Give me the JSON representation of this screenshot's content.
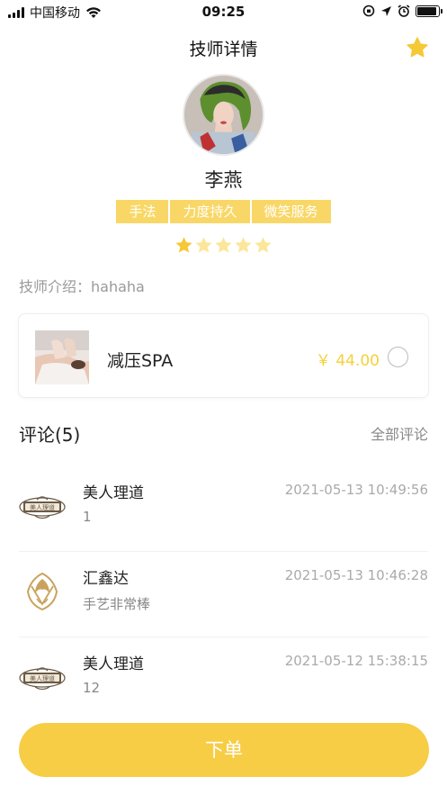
{
  "status_bar": {
    "carrier": "中国移动",
    "time": "09:25",
    "battery_level": 0.9
  },
  "header": {
    "title": "技师详情",
    "favorite_icon": "star-icon"
  },
  "technician": {
    "name": "李燕",
    "tags": [
      "手法",
      "力度持久",
      "微笑服务"
    ],
    "rating": 1,
    "rating_max": 5,
    "intro_label": "技师介绍：",
    "intro_value": "hahaha"
  },
  "service": {
    "name": "减压SPA",
    "price": "￥ 44.00",
    "selected": false
  },
  "comments": {
    "title": "评论(5)",
    "all_label": "全部评论",
    "items": [
      {
        "user": "美人理道",
        "time": "2021-05-13 10:49:56",
        "text": "1",
        "avatar": "beauty-salon-logo"
      },
      {
        "user": "汇鑫达",
        "time": "2021-05-13 10:46:28",
        "text": "手艺非常棒",
        "avatar": "phoenix-logo"
      },
      {
        "user": "美人理道",
        "time": "2021-05-12 15:38:15",
        "text": "12",
        "avatar": "beauty-salon-logo"
      }
    ]
  },
  "order_button": {
    "label": "下单"
  },
  "colors": {
    "accent": "#f7cd45",
    "tag_bg": "#f9d766",
    "price": "#f6d13a",
    "star_on": "#f5c836",
    "star_off": "#fbe69a"
  }
}
